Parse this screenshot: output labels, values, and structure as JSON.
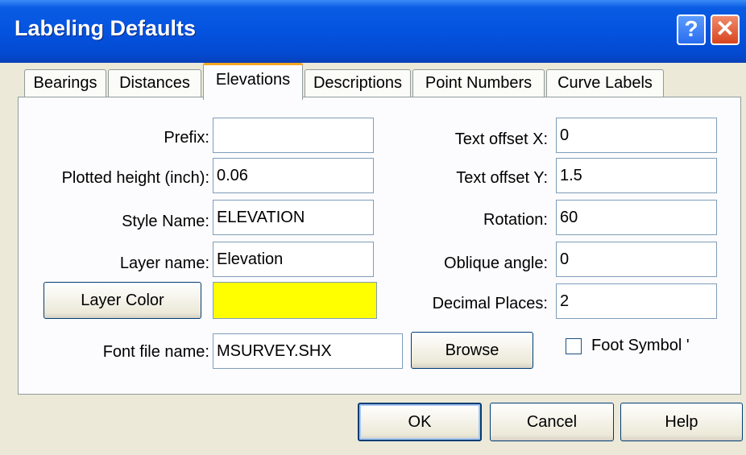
{
  "window": {
    "title": "Labeling Defaults",
    "help_glyph": "?",
    "close_glyph": "✕"
  },
  "tabs": [
    "Bearings",
    "Distances",
    "Elevations",
    "Descriptions",
    "Point Numbers",
    "Curve Labels"
  ],
  "active_tab": "Elevations",
  "form": {
    "prefix_label": "Prefix:",
    "prefix_value": "",
    "plotted_height_label": "Plotted height (inch):",
    "plotted_height_value": "0.06",
    "style_name_label": "Style Name:",
    "style_name_value": "ELEVATION",
    "layer_name_label": "Layer name:",
    "layer_name_value": "Elevation",
    "layer_color_button": "Layer Color",
    "layer_color": "#ffff00",
    "font_file_label": "Font file name:",
    "font_file_value": "MSURVEY.SHX",
    "browse_button": "Browse",
    "text_offset_x_label": "Text offset X:",
    "text_offset_x_value": "0",
    "text_offset_y_label": "Text offset Y:",
    "text_offset_y_value": "1.5",
    "rotation_label": "Rotation:",
    "rotation_value": "60",
    "oblique_angle_label": "Oblique angle:",
    "oblique_angle_value": "0",
    "decimal_places_label": "Decimal Places:",
    "decimal_places_value": "2",
    "foot_symbol_label": "Foot Symbol '",
    "foot_symbol_checked": false
  },
  "buttons": {
    "ok": "OK",
    "cancel": "Cancel",
    "help": "Help"
  },
  "colors": {
    "titlebar": "#0453e0",
    "dialog_bg": "#ece9d8",
    "tab_accent": "#f5a623"
  }
}
